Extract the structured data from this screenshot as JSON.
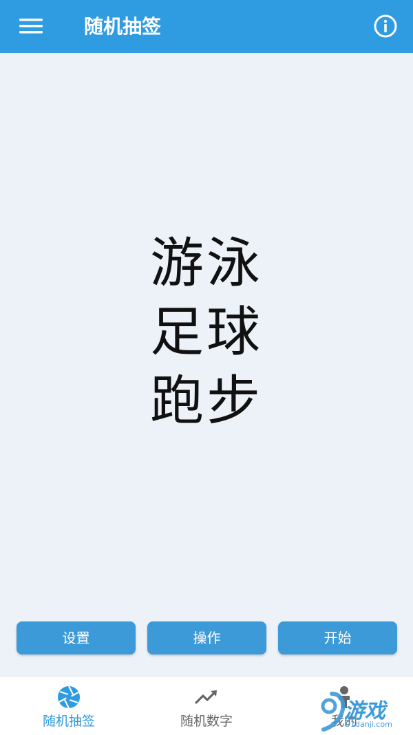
{
  "app_bar": {
    "title": "随机抽签",
    "menu_icon": "hamburger-menu-icon",
    "info_icon": "info-icon",
    "color": "#2f9be0"
  },
  "result": {
    "items": [
      "游泳",
      "足球",
      "跑步"
    ]
  },
  "actions": {
    "settings_label": "设置",
    "operate_label": "操作",
    "start_label": "开始",
    "color": "#3d9ad8"
  },
  "bottom_nav": {
    "items": [
      {
        "label": "随机抽签",
        "icon": "aperture-icon",
        "active": true
      },
      {
        "label": "随机数字",
        "icon": "trend-up-icon",
        "active": false
      },
      {
        "label": "我的",
        "icon": "person-icon",
        "active": false
      }
    ],
    "active_color": "#2f9be0",
    "inactive_color": "#666666"
  },
  "watermark": {
    "main": "游戏",
    "sub": "91danji.com"
  }
}
